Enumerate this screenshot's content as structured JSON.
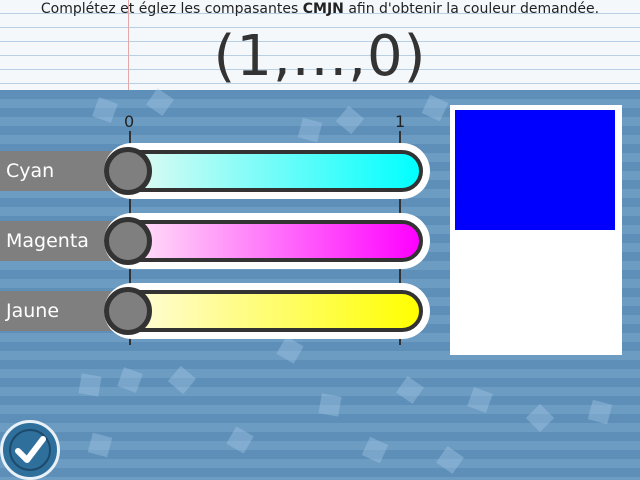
{
  "header": {
    "instruction_pre": "Complétez et églez les compasantes ",
    "instruction_bold": "CMJN",
    "instruction_post": " afin d'obtenir la couleur demandée.",
    "target_value": "(1,...,0)"
  },
  "scale": {
    "min_label": "0",
    "max_label": "1"
  },
  "sliders": [
    {
      "label": "Cyan",
      "value": 0,
      "color": "#00ffff",
      "light": "#eefaf2"
    },
    {
      "label": "Magenta",
      "value": 0,
      "color": "#ff00ff",
      "light": "#fff0f6"
    },
    {
      "label": "Jaune",
      "value": 0,
      "color": "#ffff00",
      "light": "#fffbe6"
    }
  ],
  "preview": {
    "color": "#0000ff"
  },
  "colors": {
    "background": "#5e8fb8",
    "check_button": "#2f6f9c"
  },
  "icons": {
    "submit": "check-icon"
  }
}
